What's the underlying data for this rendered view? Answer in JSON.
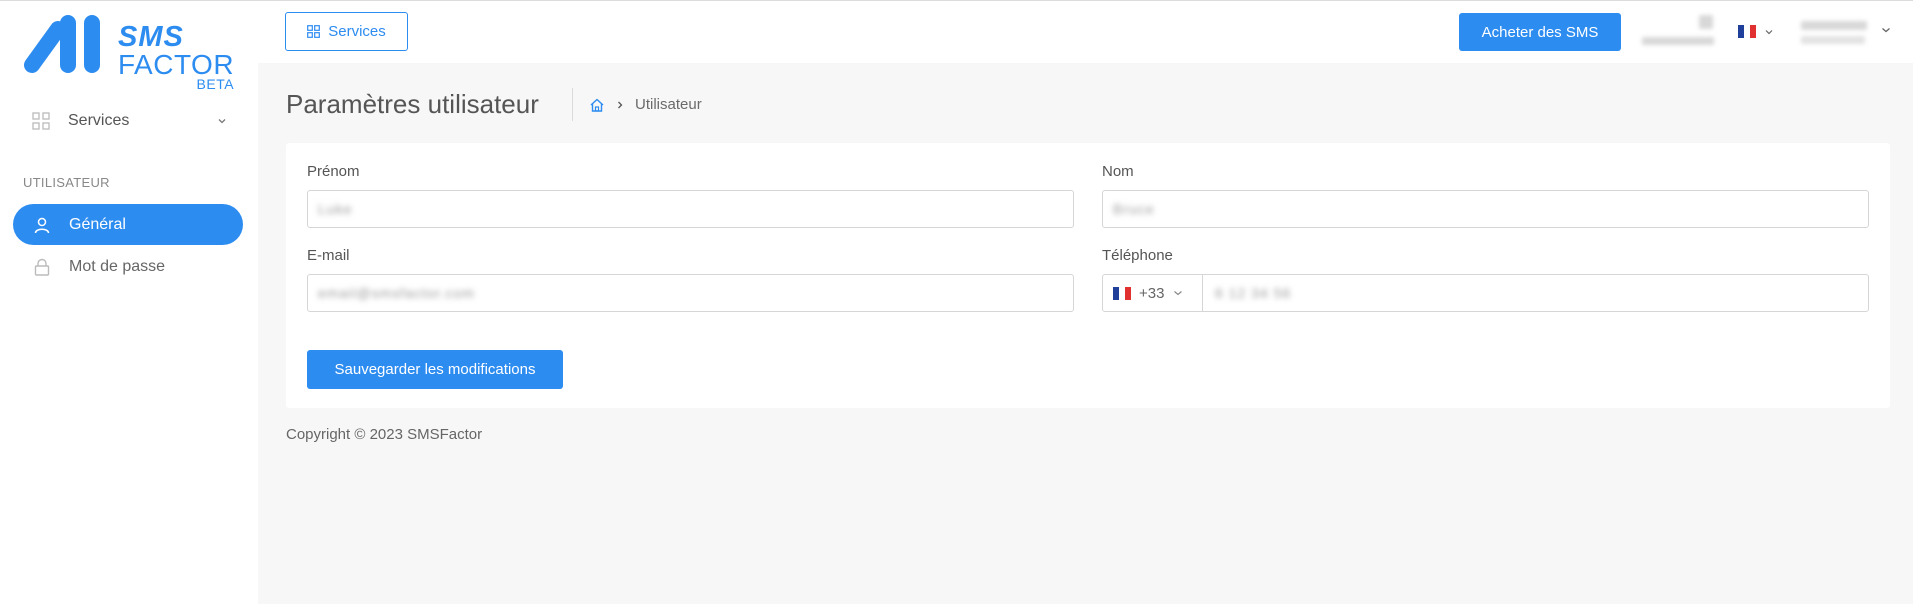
{
  "brand": {
    "line1": "SMS",
    "line2": "FACTOR",
    "badge": "BETA",
    "accent_color": "#2d8cf0"
  },
  "sidebar": {
    "services_label": "Services",
    "section_label": "UTILISATEUR",
    "items": [
      {
        "label": "Général",
        "icon": "user-icon",
        "active": true
      },
      {
        "label": "Mot de passe",
        "icon": "lock-icon",
        "active": false
      }
    ]
  },
  "header": {
    "services_button": "Services",
    "buy_button": "Acheter des SMS",
    "language_flag": "fr-flag-icon"
  },
  "page": {
    "title": "Paramètres utilisateur",
    "breadcrumb": {
      "home_icon": "home-icon",
      "current": "Utilisateur"
    }
  },
  "form": {
    "first_name": {
      "label": "Prénom",
      "value": "Luke"
    },
    "last_name": {
      "label": "Nom",
      "value": "Bruce"
    },
    "email": {
      "label": "E-mail",
      "value": "email@smsfactor.com"
    },
    "phone": {
      "label": "Téléphone",
      "country_code": "+33",
      "value": "6 12 34 56"
    },
    "save_button": "Sauvegarder les modifications"
  },
  "footer": {
    "copyright": "Copyright © 2023 SMSFactor"
  }
}
